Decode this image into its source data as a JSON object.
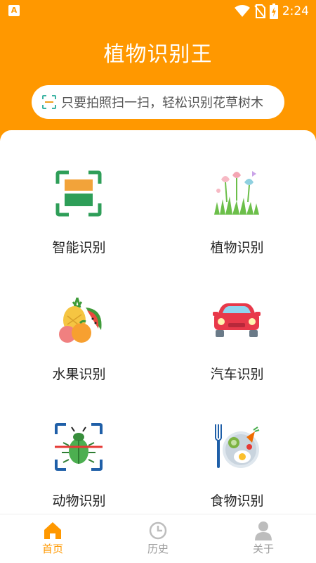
{
  "status_bar": {
    "left_icon": "A",
    "time": "2:24",
    "icons": [
      "wifi-icon",
      "no-sim-icon",
      "battery-charging-icon"
    ]
  },
  "header": {
    "title": "植物识别王",
    "search_placeholder": "只要拍照扫一扫，轻松识别花草树木",
    "accent_color": "#FF9800"
  },
  "grid": {
    "items": [
      {
        "label": "智能识别",
        "icon": "smart-scan-icon"
      },
      {
        "label": "植物识别",
        "icon": "flower-icon"
      },
      {
        "label": "水果识别",
        "icon": "fruit-icon"
      },
      {
        "label": "汽车识别",
        "icon": "car-icon"
      },
      {
        "label": "动物识别",
        "icon": "bug-scan-icon"
      },
      {
        "label": "食物识别",
        "icon": "food-plate-icon"
      }
    ]
  },
  "tabbar": {
    "tabs": [
      {
        "label": "首页",
        "icon": "home-icon",
        "active": true
      },
      {
        "label": "历史",
        "icon": "clock-icon",
        "active": false
      },
      {
        "label": "关于",
        "icon": "person-icon",
        "active": false
      }
    ],
    "active_color": "#FF9800",
    "inactive_color": "#9e9e9e"
  }
}
